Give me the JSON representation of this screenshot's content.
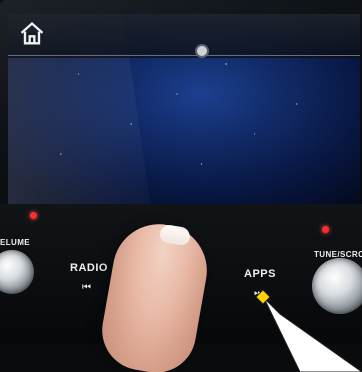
{
  "panel": {
    "radio_label": "RADIO",
    "apps_label": "APPS",
    "volume_label": "ELUME",
    "tune_label": "TUNE/SCRO"
  },
  "icons": {
    "home": "home-icon",
    "seek_back": "seek-back-icon",
    "seek_forward": "seek-forward-icon"
  },
  "colors": {
    "accent_yellow": "#ffd200",
    "indicator_red": "#ff2d2d"
  }
}
